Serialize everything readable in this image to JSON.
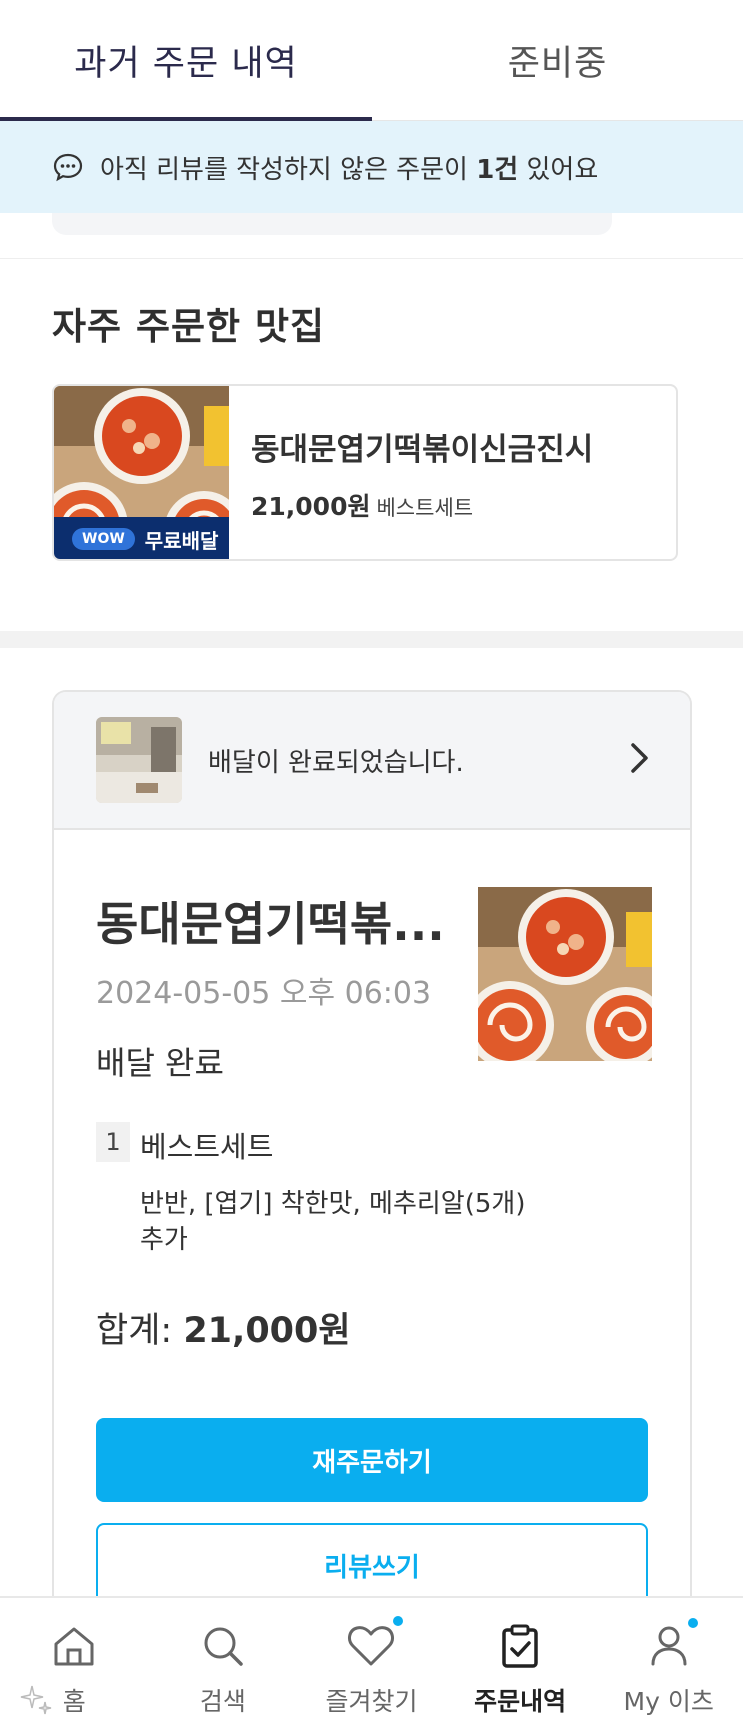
{
  "tabs": [
    {
      "label": "과거 주문 내역",
      "active": true
    },
    {
      "label": "준비중",
      "active": false
    }
  ],
  "banner": {
    "icon": "chat-bubble-icon",
    "text_before": "아직 리뷰를 작성하지 않은 주문이 ",
    "count": "1건",
    "text_after": " 있어요"
  },
  "favorites": {
    "title": "자주 주문한 맛집",
    "store": {
      "name": "동대문엽기떡볶이신금진시",
      "price": "21,000원",
      "menu": "베스트세트",
      "wow_badge": "WOW",
      "free_delivery": "무료배달"
    }
  },
  "order": {
    "status_message": "배달이 완료되었습니다.",
    "store_name": "동대문엽기떡볶...",
    "date": "2024-05-05 오후 06:03",
    "status": "배달 완료",
    "item": {
      "qty": "1",
      "name": "베스트세트",
      "options_line1": "반반, [엽기] 착한맛, 메추리알(5개)",
      "options_line2": "추가"
    },
    "total_label": "합계: ",
    "total_value": "21,000원",
    "reorder_label": "재주문하기",
    "review_label": "리뷰쓰기"
  },
  "nav": [
    {
      "label": "홈",
      "icon": "home-icon"
    },
    {
      "label": "검색",
      "icon": "search-icon"
    },
    {
      "label": "즐겨찾기",
      "icon": "heart-icon",
      "dot": true
    },
    {
      "label": "주문내역",
      "icon": "clipboard-check-icon",
      "active": true
    },
    {
      "label": "My 이츠",
      "icon": "person-icon",
      "dot": true
    }
  ],
  "colors": {
    "accent": "#0aaeef",
    "navy": "#2b2a4c",
    "banner_bg": "#e3f3fb"
  }
}
